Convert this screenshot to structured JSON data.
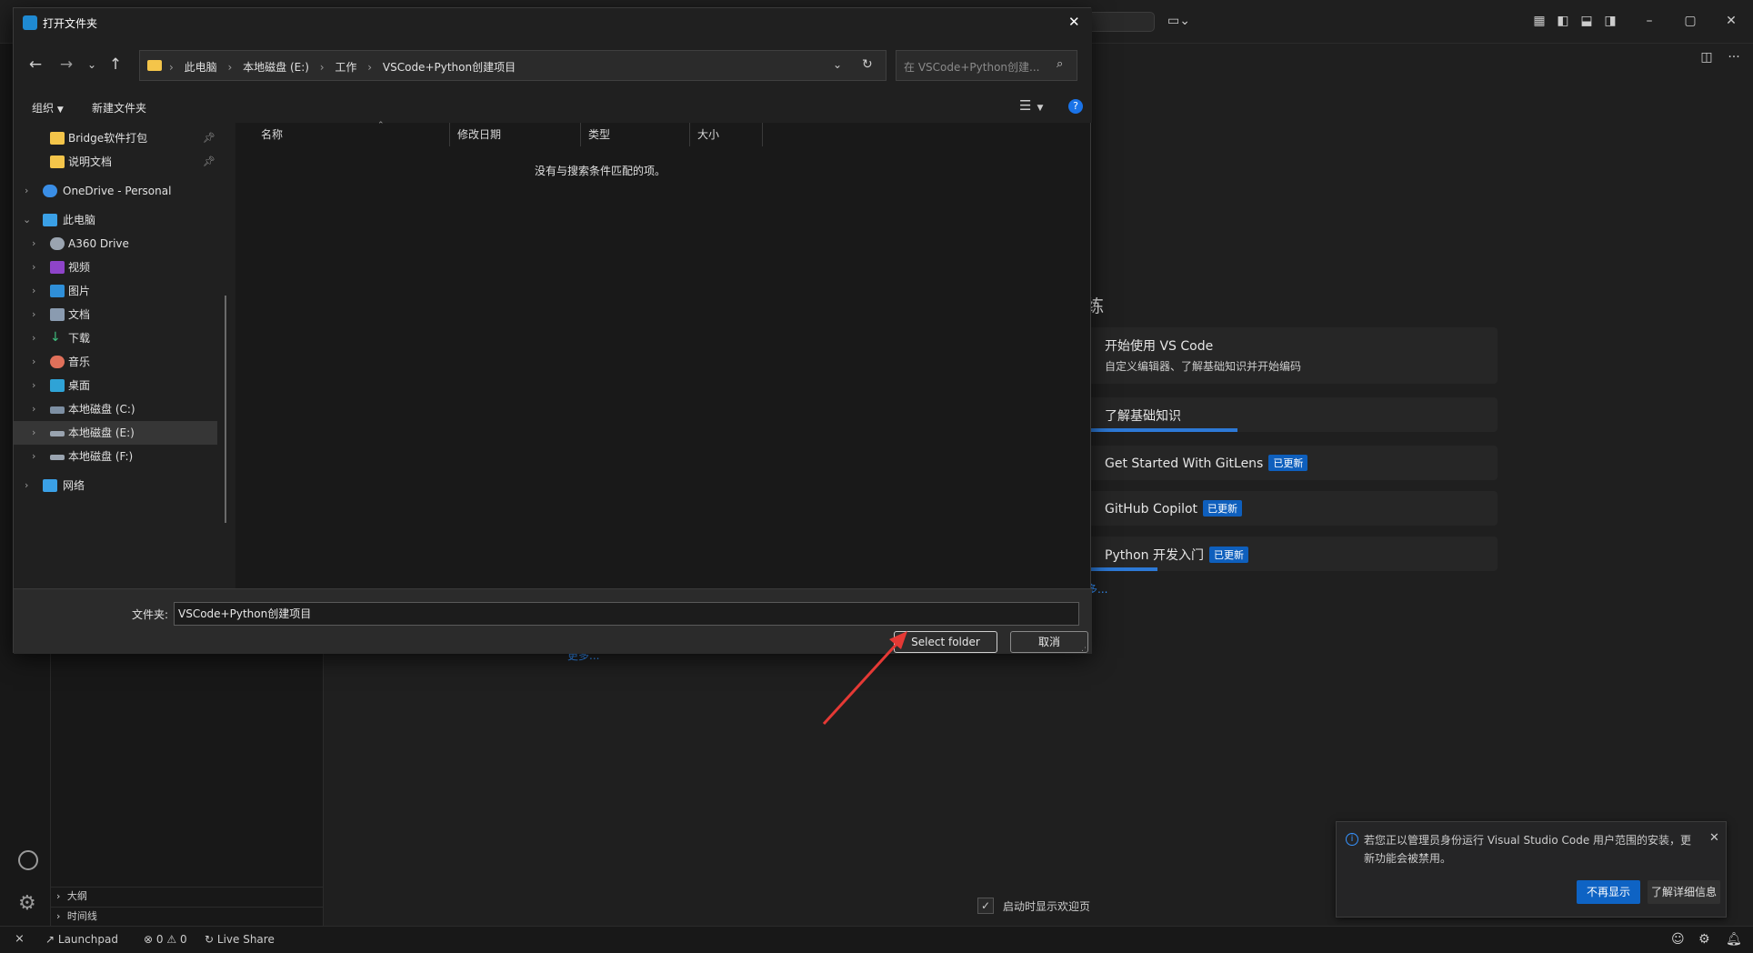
{
  "dialog": {
    "title": "打开文件夹",
    "breadcrumb": [
      "此电脑",
      "本地磁盘 (E:)",
      "工作",
      "VSCode+Python创建项目"
    ],
    "search_placeholder": "在 VSCode+Python创建...",
    "toolbar": {
      "organize": "组织",
      "new_folder": "新建文件夹"
    },
    "nav": {
      "quick_access": [
        {
          "label": "Bridge软件打包"
        },
        {
          "label": "说明文档"
        }
      ],
      "onedrive": "OneDrive - Personal",
      "this_pc": "此电脑",
      "pc_items": [
        {
          "label": "A360 Drive"
        },
        {
          "label": "视频"
        },
        {
          "label": "图片"
        },
        {
          "label": "文档"
        },
        {
          "label": "下载"
        },
        {
          "label": "音乐"
        },
        {
          "label": "桌面"
        },
        {
          "label": "本地磁盘 (C:)"
        },
        {
          "label": "本地磁盘 (E:)"
        },
        {
          "label": "本地磁盘 (F:)"
        }
      ],
      "network": "网络"
    },
    "columns": [
      "名称",
      "修改日期",
      "类型",
      "大小"
    ],
    "empty_message": "没有与搜索条件匹配的项。",
    "folder_label": "文件夹:",
    "folder_value": "VSCode+Python创建项目",
    "select_button": "Select folder",
    "cancel_button": "取消"
  },
  "welcome": {
    "heading_fragment": "练",
    "cards": [
      {
        "title": "开始使用 VS Code",
        "desc": "自定义编辑器、了解基础知识并开始编码",
        "badge": "",
        "progress": 0
      },
      {
        "title": "了解基础知识",
        "desc": "",
        "badge": "",
        "progress": 0.38
      },
      {
        "title": "Get Started With GitLens",
        "desc": "",
        "badge": "已更新",
        "progress": 0
      },
      {
        "title": "GitHub Copilot",
        "desc": "",
        "badge": "已更新",
        "progress": 0
      },
      {
        "title": "Python 开发入门",
        "desc": "",
        "badge": "已更新",
        "progress": 0.19
      }
    ],
    "more_right": "多...",
    "more_left": "更多...",
    "show_on_startup": "启动时显示欢迎页"
  },
  "sidebar": {
    "outline": "大纲",
    "timeline": "时间线"
  },
  "statusbar": {
    "launchpad": "Launchpad",
    "errors": "0",
    "warnings": "0",
    "live_share": "Live Share"
  },
  "notification": {
    "message": "若您正以管理员身份运行 Visual Studio Code 用户范围的安装，更新功能会被禁用。",
    "primary": "不再显示",
    "secondary": "了解详细信息"
  },
  "colors": {
    "accent": "#0e63c4",
    "progress": "#2d79d6",
    "annotation_arrow": "#e53935"
  }
}
